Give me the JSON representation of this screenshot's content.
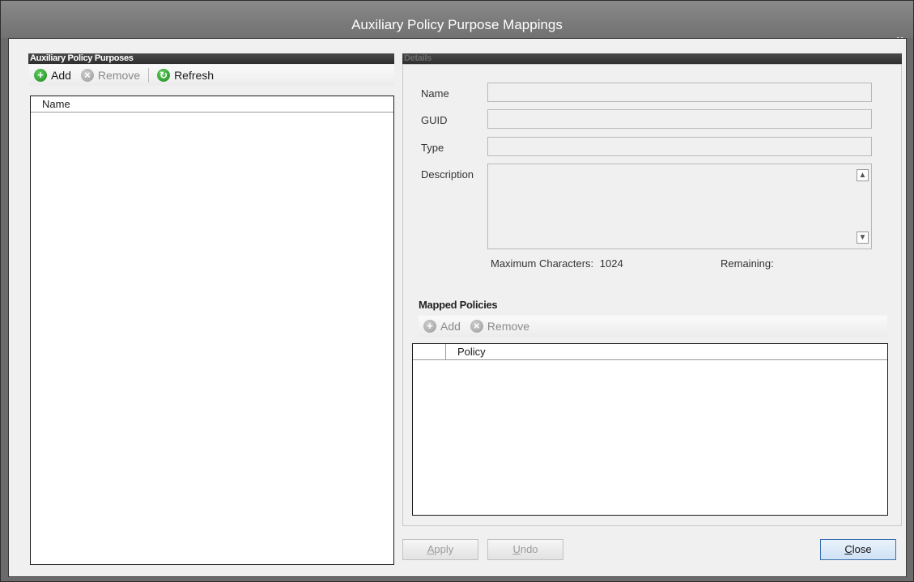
{
  "window": {
    "title": "Auxiliary Policy Purpose Mappings",
    "close_glyph": "x"
  },
  "left": {
    "group_title": "Auxiliary Policy Purposes",
    "toolbar": {
      "add": "Add",
      "remove": "Remove",
      "refresh": "Refresh"
    },
    "list": {
      "column": "Name"
    }
  },
  "details": {
    "group_title": "Details",
    "name_label": "Name",
    "guid_label": "GUID",
    "type_label": "Type",
    "description_label": "Description",
    "max_chars_label": "Maximum Characters:",
    "max_chars_value": "1024",
    "remaining_label": "Remaining:",
    "mapped": {
      "title": "Mapped Policies",
      "toolbar": {
        "add": "Add",
        "remove": "Remove"
      },
      "list": {
        "column": "Policy"
      }
    }
  },
  "buttons": {
    "apply_first": "A",
    "apply_rest": "pply",
    "undo_first": "U",
    "undo_rest": "ndo",
    "close_first": "C",
    "close_rest": "lose"
  },
  "icons": {
    "add": "plus-circle-icon",
    "remove": "x-circle-icon",
    "refresh": "refresh-circle-icon"
  }
}
